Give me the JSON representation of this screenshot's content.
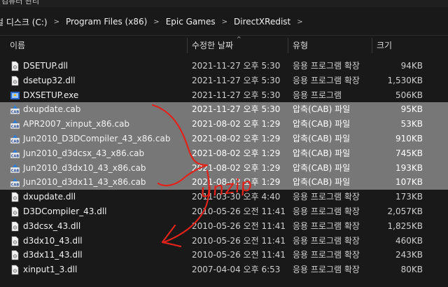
{
  "window": {
    "title_fragment": "컴퓨터 관리"
  },
  "breadcrumb": [
    "컬 디스크 (C:)",
    "Program Files (x86)",
    "Epic Games",
    "DirectXRedist"
  ],
  "columns": {
    "name": "이름",
    "date": "수정한 날짜",
    "type": "유형",
    "size": "크기"
  },
  "files": [
    {
      "name": "DSETUP.dll",
      "date": "2021-11-27 오후 5:30",
      "type": "응용 프로그램 확장",
      "size": "94KB",
      "icon": "dll-icon",
      "selected": false
    },
    {
      "name": "dsetup32.dll",
      "date": "2021-11-27 오후 5:30",
      "type": "응용 프로그램 확장",
      "size": "1,530KB",
      "icon": "dll-icon",
      "selected": false
    },
    {
      "name": "DXSETUP.exe",
      "date": "2021-11-27 오후 5:30",
      "type": "응용 프로그램",
      "size": "506KB",
      "icon": "exe-icon",
      "selected": false
    },
    {
      "name": "dxupdate.cab",
      "date": "2021-11-27 오후 5:30",
      "type": "압축(CAB) 파일",
      "size": "95KB",
      "icon": "cab-icon",
      "selected": true
    },
    {
      "name": "APR2007_xinput_x86.cab",
      "date": "2021-08-02 오후 1:29",
      "type": "압축(CAB) 파일",
      "size": "53KB",
      "icon": "cab-icon",
      "selected": true
    },
    {
      "name": "Jun2010_D3DCompiler_43_x86.cab",
      "date": "2021-08-02 오후 1:29",
      "type": "압축(CAB) 파일",
      "size": "910KB",
      "icon": "cab-icon",
      "selected": true
    },
    {
      "name": "Jun2010_d3dcsx_43_x86.cab",
      "date": "2021-08-02 오후 1:29",
      "type": "압축(CAB) 파일",
      "size": "745KB",
      "icon": "cab-icon",
      "selected": true
    },
    {
      "name": "Jun2010_d3dx10_43_x86.cab",
      "date": "2021-08-02 오후 1:29",
      "type": "압축(CAB) 파일",
      "size": "193KB",
      "icon": "cab-icon",
      "selected": true
    },
    {
      "name": "Jun2010_d3dx11_43_x86.cab",
      "date": "2021-08-02 오후 1:29",
      "type": "압축(CAB) 파일",
      "size": "107KB",
      "icon": "cab-icon",
      "selected": true
    },
    {
      "name": "dxupdate.dll",
      "date": "2011-03-30 오후 4:40",
      "type": "응용 프로그램 확장",
      "size": "173KB",
      "icon": "dll-icon",
      "selected": false
    },
    {
      "name": "D3DCompiler_43.dll",
      "date": "2010-05-26 오전 11:41",
      "type": "응용 프로그램 확장",
      "size": "2,057KB",
      "icon": "dll-icon",
      "selected": false
    },
    {
      "name": "d3dcsx_43.dll",
      "date": "2010-05-26 오전 11:41",
      "type": "응용 프로그램 확장",
      "size": "1,825KB",
      "icon": "dll-icon",
      "selected": false
    },
    {
      "name": "d3dx10_43.dll",
      "date": "2010-05-26 오전 11:41",
      "type": "응용 프로그램 확장",
      "size": "460KB",
      "icon": "dll-icon",
      "selected": false
    },
    {
      "name": "d3dx11_43.dll",
      "date": "2010-05-26 오전 11:41",
      "type": "응용 프로그램 확장",
      "size": "243KB",
      "icon": "dll-icon",
      "selected": false
    },
    {
      "name": "xinput1_3.dll",
      "date": "2007-04-04 오후 6:53",
      "type": "응용 프로그램 확장",
      "size": "80KB",
      "icon": "dll-icon",
      "selected": false
    }
  ],
  "annotation": {
    "text": "unzip",
    "color": "#e0231b"
  }
}
